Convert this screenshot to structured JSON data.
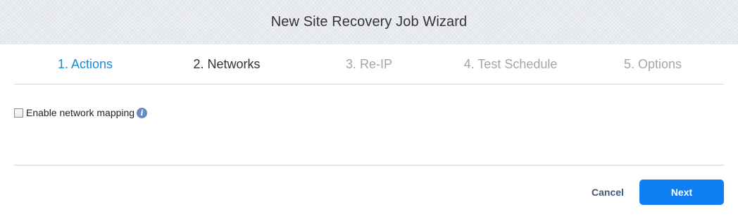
{
  "window": {
    "title": "New Site Recovery Job Wizard"
  },
  "steps": [
    {
      "label": "1. Actions",
      "state": "active"
    },
    {
      "label": "2. Networks",
      "state": "current"
    },
    {
      "label": "3. Re-IP",
      "state": "disabled"
    },
    {
      "label": "4. Test Schedule",
      "state": "disabled"
    },
    {
      "label": "5. Options",
      "state": "disabled"
    }
  ],
  "content": {
    "enable_network_mapping": {
      "label": "Enable network mapping",
      "checked": false,
      "info_icon": "info-icon"
    }
  },
  "footer": {
    "cancel_label": "Cancel",
    "next_label": "Next"
  },
  "colors": {
    "active_step": "#1a8bd0",
    "current_step": "#333333",
    "disabled_step": "#a3a6a9",
    "primary_button": "#0d7ff2",
    "cancel_text": "#3c5a7a",
    "info_icon": "#6688c4"
  }
}
